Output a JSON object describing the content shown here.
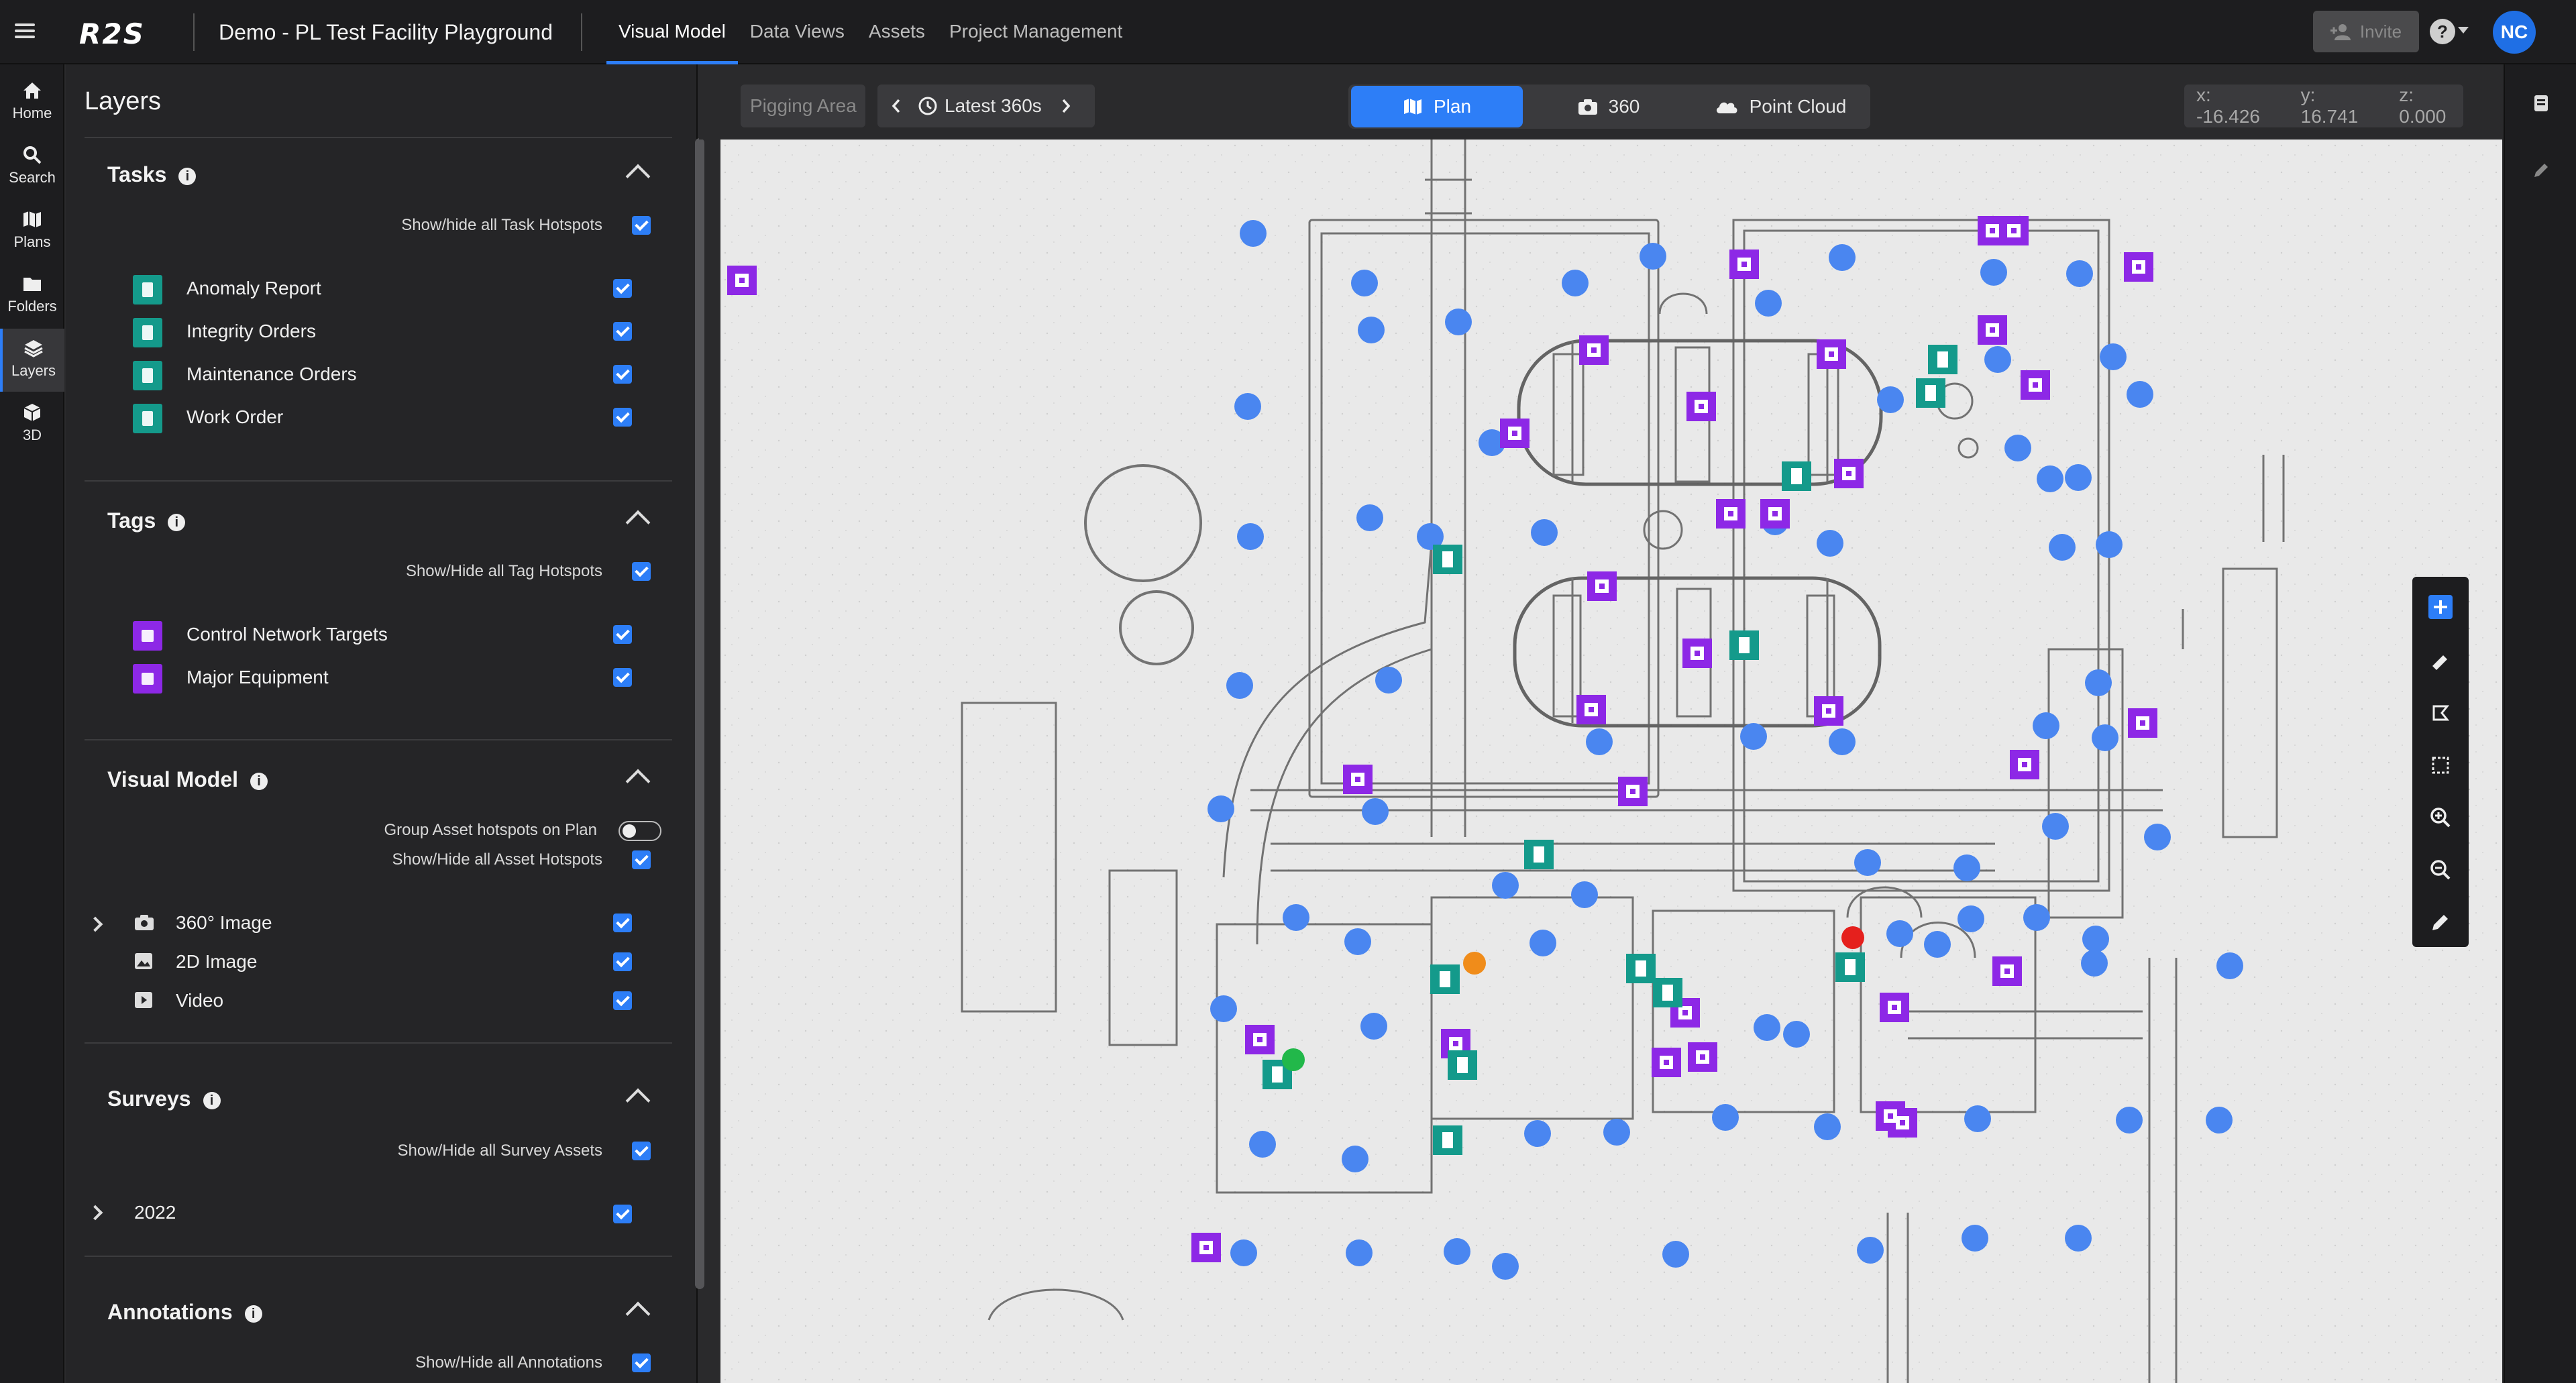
{
  "app": {
    "logo": "R2S",
    "project_title": "Demo - PL Test Facility Playground",
    "tabs": [
      {
        "label": "Visual Model",
        "active": true
      },
      {
        "label": "Data Views",
        "active": false
      },
      {
        "label": "Assets",
        "active": false
      },
      {
        "label": "Project Management",
        "active": false
      }
    ],
    "invite_label": "Invite",
    "help_label": "?",
    "avatar_initials": "NC"
  },
  "rail": [
    {
      "label": "Home",
      "icon": "home-icon"
    },
    {
      "label": "Search",
      "icon": "search-icon"
    },
    {
      "label": "Plans",
      "icon": "map-icon"
    },
    {
      "label": "Folders",
      "icon": "folder-icon"
    },
    {
      "label": "Layers",
      "icon": "layers-icon",
      "active": true
    },
    {
      "label": "3D",
      "icon": "cube-icon"
    }
  ],
  "layers": {
    "title": "Layers",
    "tasks": {
      "title": "Tasks",
      "show_all_label": "Show/hide all Task Hotspots",
      "items": [
        "Anomaly Report",
        "Integrity Orders",
        "Maintenance Orders",
        "Work Order"
      ]
    },
    "tags": {
      "title": "Tags",
      "show_all_label": "Show/Hide all Tag Hotspots",
      "items": [
        "Control Network Targets",
        "Major Equipment"
      ]
    },
    "visual_model": {
      "title": "Visual Model",
      "group_label": "Group Asset hotspots on Plan",
      "show_all_label": "Show/Hide all Asset Hotspots",
      "items": [
        "360° Image",
        "2D Image",
        "Video"
      ]
    },
    "surveys": {
      "title": "Surveys",
      "show_all_label": "Show/Hide all Survey Assets",
      "items": [
        "2022"
      ]
    },
    "annotations": {
      "title": "Annotations",
      "show_all_label": "Show/Hide all Annotations"
    }
  },
  "mapbar": {
    "area_label": "Pigging Area",
    "capture_label": "Latest 360s",
    "views": [
      "Plan",
      "360",
      "Point Cloud"
    ],
    "active_view": "Plan",
    "coords": {
      "x": "x: -16.426",
      "y": "y: 16.741",
      "z": "z: 0.000"
    }
  },
  "colors": {
    "accent": "#2d7ef7",
    "task_hotspot": "#149a8b",
    "tag_hotspot": "#8d28e6",
    "image_360": "#4a86f0"
  }
}
